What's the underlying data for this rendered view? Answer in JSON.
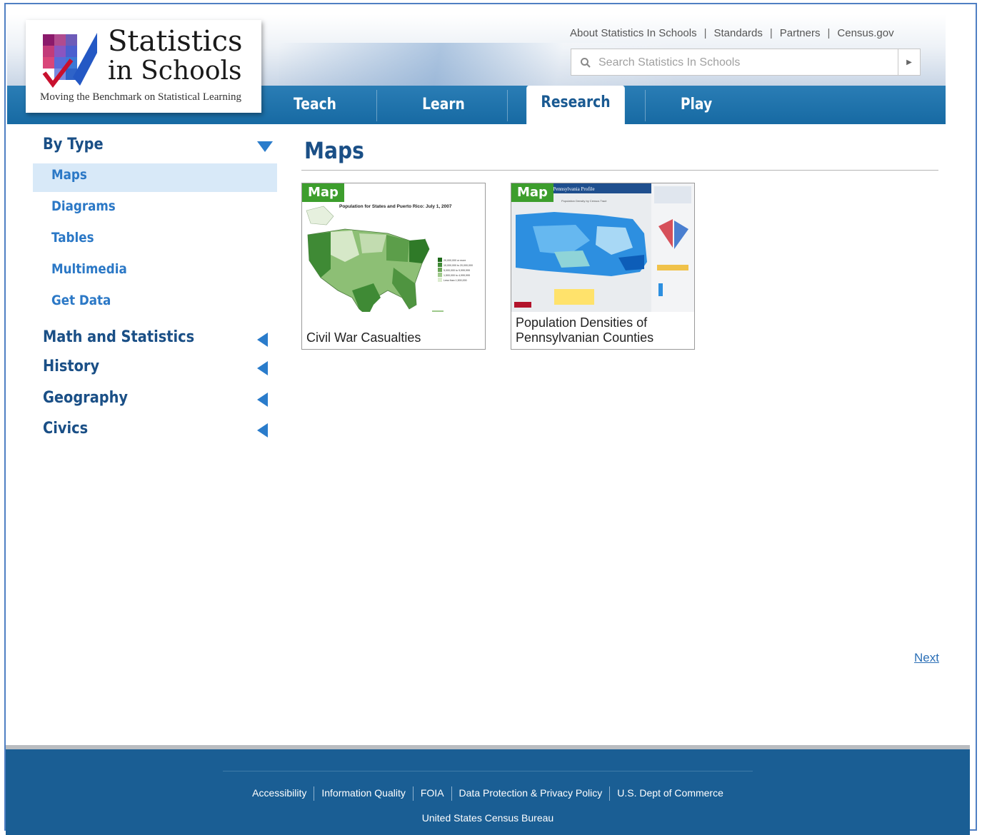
{
  "brand": {
    "title": "Statistics",
    "subtitle": "in Schools",
    "tagline": "Moving the Benchmark on Statistical Learning"
  },
  "toplinks": [
    "About Statistics In Schools",
    "Standards",
    "Partners",
    "Census.gov"
  ],
  "search": {
    "placeholder": "Search Statistics In Schools"
  },
  "tabs": [
    {
      "label": "Teach",
      "active": false
    },
    {
      "label": "Learn",
      "active": false
    },
    {
      "label": "Research",
      "active": true
    },
    {
      "label": "Play",
      "active": false
    }
  ],
  "sidebar": {
    "by_type": "By Type",
    "types": [
      "Maps",
      "Diagrams",
      "Tables",
      "Multimedia",
      "Get Data"
    ],
    "selected": "Maps",
    "sections": [
      "Math and Statistics",
      "History",
      "Geography",
      "Civics"
    ]
  },
  "main": {
    "title": "Maps",
    "cards": [
      {
        "badge": "Map",
        "thumb_title": "Population for States and Puerto Rico: July 1, 2007",
        "legend": [
          "20,000,000 or more",
          "10,000,000 to 20,000,000",
          "5,000,000 to 9,999,999",
          "1,500,000 to 4,999,999",
          "Less than 1,500,000"
        ],
        "caption": "Civil War Casualties"
      },
      {
        "badge": "Map",
        "thumb_title": "s: Pennsylvania Profile",
        "thumb_sub": "Population Density by Census Tract",
        "caption_lines": [
          "Population Densities of",
          "Pennsylvanian Counties"
        ]
      }
    ],
    "next": "Next"
  },
  "footer": {
    "links": [
      "Accessibility",
      "Information Quality",
      "FOIA",
      "Data Protection & Privacy Policy",
      "U.S. Dept of Commerce"
    ],
    "org": "United States Census Bureau"
  },
  "colors": {
    "nav_blue": "#1a6aa3",
    "heading_blue": "#1a4f86",
    "link_blue": "#2b78c6",
    "badge_green": "#3d9e2d",
    "footer_blue": "#1a5e94"
  }
}
